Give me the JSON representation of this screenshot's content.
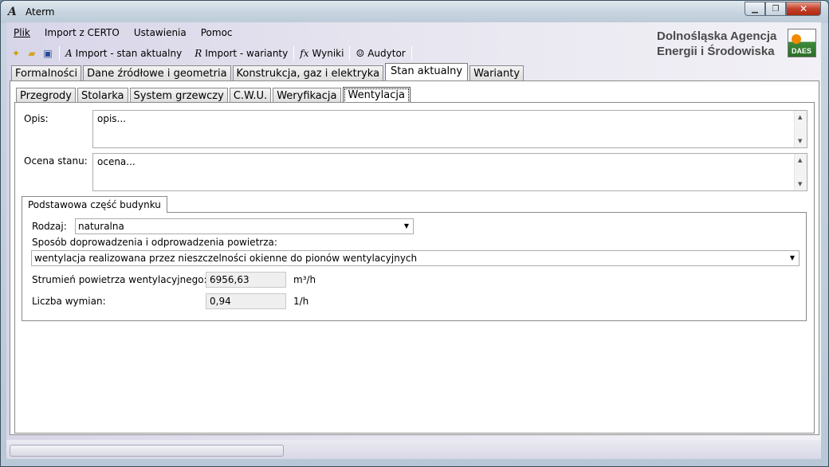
{
  "window": {
    "title": "Aterm",
    "minimize_icon": "minimize-icon",
    "maximize_icon": "restore-icon",
    "close_icon": "close-icon"
  },
  "menu": {
    "items": [
      {
        "label": "Plik",
        "accel": "P",
        "rest": "lik"
      },
      {
        "label": "Import z CERTO",
        "accel": "I",
        "rest": "mport z CERTO"
      },
      {
        "label": "Ustawienia",
        "accel": "U",
        "rest": "stawienia"
      },
      {
        "label": "Pomoc",
        "accel": "P",
        "pre": "",
        "rest": "omoc"
      }
    ]
  },
  "toolbar": {
    "import_current": "Import - stan aktualny",
    "import_variants": "Import - warianty",
    "results": "Wyniki",
    "auditor": "Audytor"
  },
  "logo": {
    "line1": "Dolnośląska Agencja",
    "line2": "Energii i Środowiska",
    "badge": "DAES"
  },
  "main_tabs": [
    "Formalności",
    "Dane źródłowe i geometria",
    "Konstrukcja, gaz i elektryka",
    "Stan aktualny",
    "Warianty"
  ],
  "sub_tabs": [
    "Przegrody",
    "Stolarka",
    "System grzewczy",
    "C.W.U.",
    "Weryfikacja",
    "Wentylacja"
  ],
  "form": {
    "opis_label": "Opis:",
    "opis_value": "opis...",
    "ocena_label": "Ocena stanu:",
    "ocena_value": "ocena...",
    "group_title": "Podstawowa część budynku",
    "rodzaj_label": "Rodzaj:",
    "rodzaj_value": "naturalna",
    "sposob_label": "Sposób doprowadzenia i odprowadzenia powietrza:",
    "sposob_value": "wentylacja realizowana przez nieszczelności okienne do pionów wentylacyjnych",
    "strumien_label": "Strumień powietrza wentylacyjnego:",
    "strumien_value": "6956,63",
    "strumien_unit": "m³/h",
    "wymian_label": "Liczba wymian:",
    "wymian_value": "0,94",
    "wymian_unit": "1/h"
  }
}
